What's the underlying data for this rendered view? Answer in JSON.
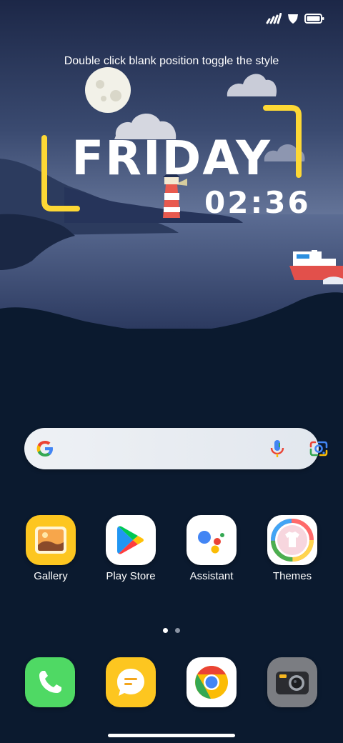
{
  "status_bar": {
    "icons": [
      "signal-icon",
      "wifi-icon",
      "battery-icon"
    ]
  },
  "clock_widget": {
    "hint": "Double click blank position toggle the style",
    "day": "FRIDAY",
    "time": "02:36"
  },
  "search_bar": {
    "icons": [
      "google-g-icon",
      "microphone-icon",
      "google-lens-icon"
    ]
  },
  "apps": [
    {
      "label": "Gallery",
      "icon": "gallery-icon"
    },
    {
      "label": "Play Store",
      "icon": "play-store-icon"
    },
    {
      "label": "Assistant",
      "icon": "assistant-icon"
    },
    {
      "label": "Themes",
      "icon": "themes-icon"
    }
  ],
  "page_indicator": {
    "pages": 2,
    "current": 1
  },
  "dock": [
    {
      "icon": "phone-icon"
    },
    {
      "icon": "messages-icon"
    },
    {
      "icon": "chrome-icon"
    },
    {
      "icon": "camera-icon"
    }
  ],
  "colors": {
    "accent_yellow": "#fdd835",
    "night_sky_top": "#1d2a4d",
    "night_sky_bottom": "#5a6a8e",
    "dark_water": "#0b1a2f"
  }
}
